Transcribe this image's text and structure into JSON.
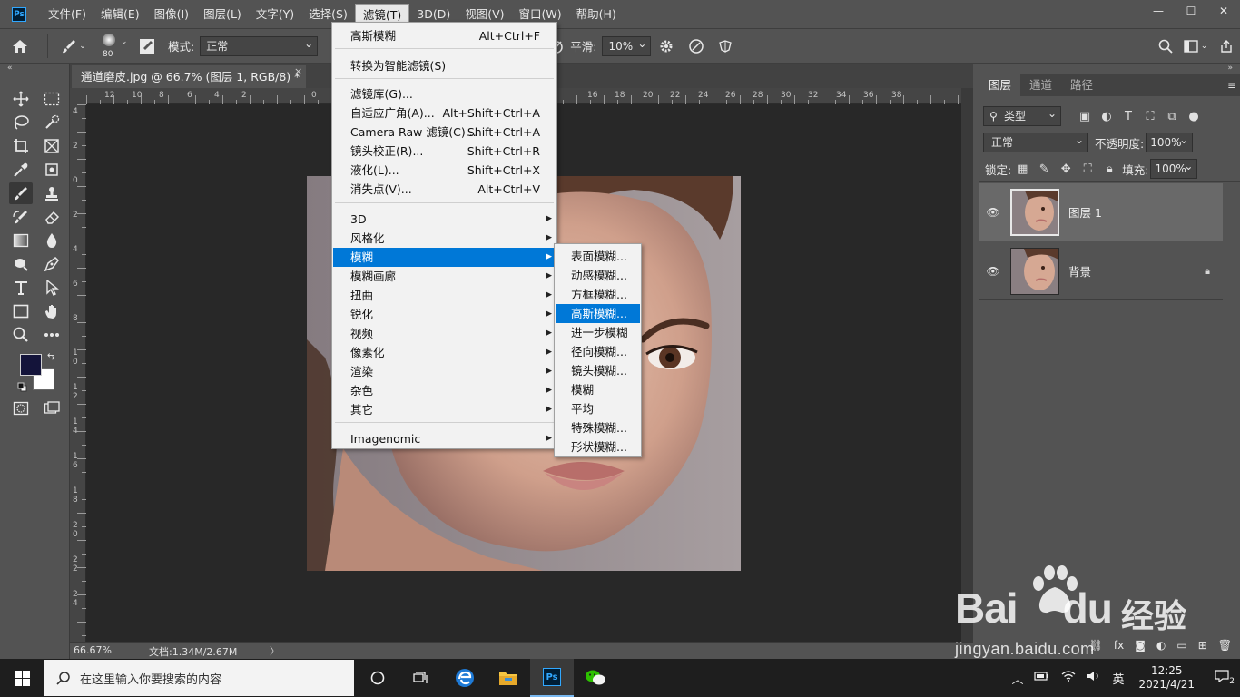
{
  "app": {
    "logo_text": "Ps"
  },
  "menubar": {
    "items": [
      "文件(F)",
      "编辑(E)",
      "图像(I)",
      "图层(L)",
      "文字(Y)",
      "选择(S)",
      "滤镜(T)",
      "3D(D)",
      "视图(V)",
      "窗口(W)",
      "帮助(H)"
    ],
    "active_index": 6
  },
  "window_controls": {
    "minimize": "—",
    "maximize": "☐",
    "close": "✕"
  },
  "options_bar": {
    "brush_size": "80",
    "mode_label": "模式:",
    "mode_value": "正常",
    "smoothing_label": "平滑:",
    "smoothing_value": "10%"
  },
  "document": {
    "tab_title": "通道磨皮.jpg @ 66.7% (图层 1, RGB/8) *",
    "tab_close": "×",
    "zoom": "66.67%",
    "doc_info": "文档:1.34M/2.67M",
    "status_arrow": "〉"
  },
  "ruler": {
    "h_ticks": [
      "12",
      "10",
      "8",
      "6",
      "4",
      "2",
      "0",
      "16",
      "18",
      "20",
      "22",
      "24",
      "26",
      "28",
      "30",
      "32",
      "34",
      "36",
      "38"
    ],
    "v_ticks": [
      "4",
      "2",
      "0",
      "2",
      "4",
      "6",
      "8",
      "1 0",
      "1 2",
      "1 4",
      "1 6",
      "1 8",
      "2 0",
      "2 2",
      "2 4"
    ]
  },
  "filter_menu": {
    "items": [
      {
        "label": "高斯模糊",
        "shortcut": "Alt+Ctrl+F"
      },
      {
        "label": "转换为智能滤镜(S)",
        "shortcut": ""
      },
      {
        "label": "滤镜库(G)...",
        "shortcut": ""
      },
      {
        "label": "自适应广角(A)...",
        "shortcut": "Alt+Shift+Ctrl+A"
      },
      {
        "label": "Camera Raw 滤镜(C)...",
        "shortcut": "Shift+Ctrl+A"
      },
      {
        "label": "镜头校正(R)...",
        "shortcut": "Shift+Ctrl+R"
      },
      {
        "label": "液化(L)...",
        "shortcut": "Shift+Ctrl+X"
      },
      {
        "label": "消失点(V)...",
        "shortcut": "Alt+Ctrl+V"
      },
      {
        "label": "3D",
        "shortcut": ""
      },
      {
        "label": "风格化",
        "shortcut": ""
      },
      {
        "label": "模糊",
        "shortcut": ""
      },
      {
        "label": "模糊画廊",
        "shortcut": ""
      },
      {
        "label": "扭曲",
        "shortcut": ""
      },
      {
        "label": "锐化",
        "shortcut": ""
      },
      {
        "label": "视频",
        "shortcut": ""
      },
      {
        "label": "像素化",
        "shortcut": ""
      },
      {
        "label": "渲染",
        "shortcut": ""
      },
      {
        "label": "杂色",
        "shortcut": ""
      },
      {
        "label": "其它",
        "shortcut": ""
      },
      {
        "label": "Imagenomic",
        "shortcut": ""
      }
    ],
    "submenu_arrow": "▶",
    "highlighted": "模糊"
  },
  "blur_submenu": {
    "items": [
      "表面模糊...",
      "动感模糊...",
      "方框模糊...",
      "高斯模糊...",
      "进一步模糊",
      "径向模糊...",
      "镜头模糊...",
      "模糊",
      "平均",
      "特殊模糊...",
      "形状模糊..."
    ],
    "highlighted": "高斯模糊..."
  },
  "layers_panel": {
    "tabs": [
      "图层",
      "通道",
      "路径"
    ],
    "active_tab": "图层",
    "filter_kind": "类型",
    "blend_mode": "正常",
    "opacity_label": "不透明度:",
    "opacity_value": "100%",
    "lock_label": "锁定:",
    "fill_label": "填充:",
    "fill_value": "100%",
    "layers": [
      {
        "name": "图层 1",
        "selected": true,
        "locked": false
      },
      {
        "name": "背景",
        "selected": false,
        "locked": true
      }
    ],
    "bottom_icons": [
      "link-icon",
      "fx-icon",
      "mask-icon",
      "adjustment-icon",
      "group-icon",
      "new-layer-icon",
      "trash-icon"
    ],
    "fx_label": "fx"
  },
  "colors": {
    "foreground": "#14143a",
    "background": "#ffffff",
    "highlight": "#0078d7"
  },
  "taskbar": {
    "search_placeholder": "在这里输入你要搜索的内容",
    "ime": "英",
    "time": "12:25",
    "date": "2021/4/21",
    "notifications": "2"
  },
  "watermark": {
    "brand": "Bai",
    "brand_suffix": "du",
    "cn": "经验",
    "url": "jingyan.baidu.com"
  }
}
